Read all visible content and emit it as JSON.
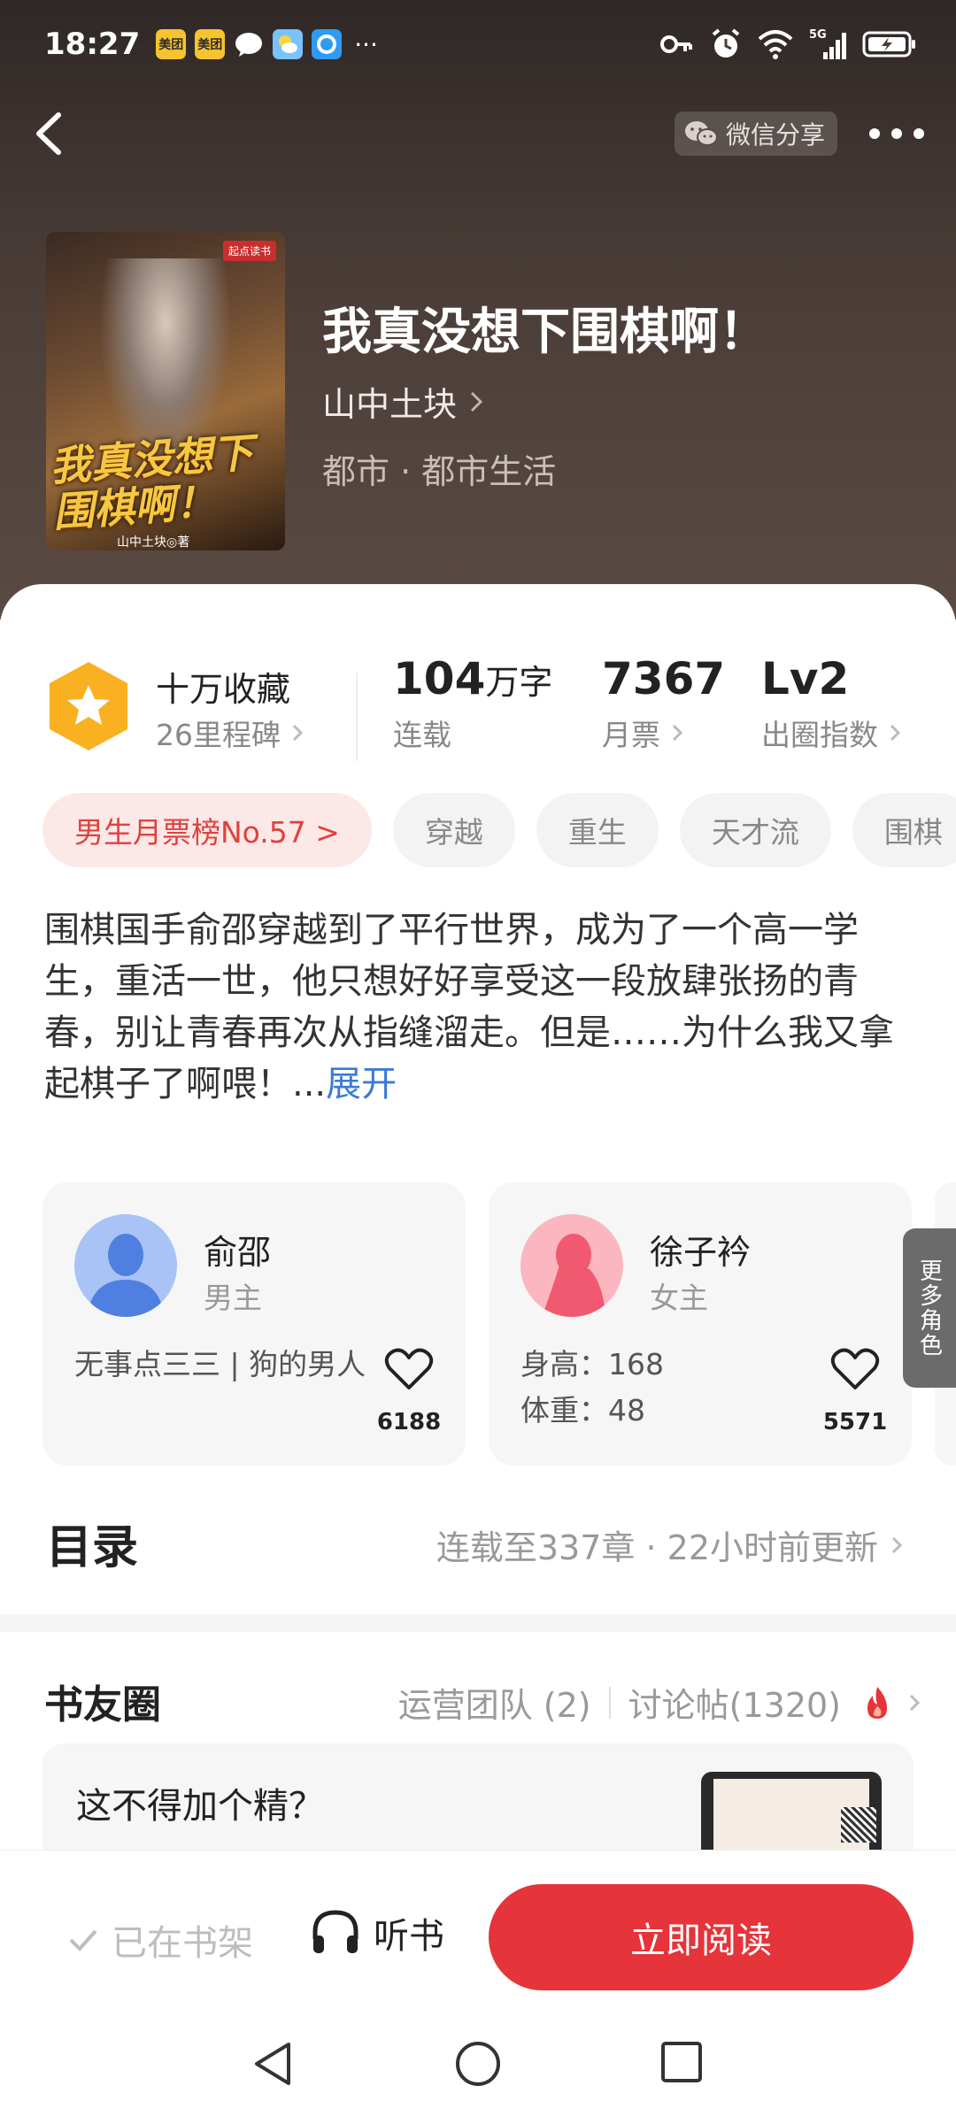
{
  "status_bar": {
    "time": "18:27",
    "app_icons": [
      {
        "name": "meituan-icon",
        "label": "美团",
        "color": "#f7c32e"
      },
      {
        "name": "meituan-icon",
        "label": "美团",
        "color": "#f7c32e"
      },
      {
        "name": "message-icon",
        "label": "",
        "color": "#ffffff"
      },
      {
        "name": "weather-icon",
        "label": "",
        "color": "#78c2ff"
      },
      {
        "name": "browser-icon",
        "label": "",
        "color": "#2f9bf0"
      }
    ],
    "more": "···",
    "network": "5G"
  },
  "header": {
    "share_label": "微信分享",
    "cover_tag": "起点读书",
    "cover_title": "我真没想下围棋啊！",
    "cover_subtitle": "山中土块◎著"
  },
  "book": {
    "title": "我真没想下围棋啊！",
    "author": "山中土块",
    "genre": "都市 · 都市生活"
  },
  "stats": {
    "favorites_title": "十万收藏",
    "favorites_sub": "26里程碑",
    "words_num": "104",
    "words_unit": "万字",
    "words_label": "连载",
    "tickets_num": "7367",
    "tickets_label": "月票",
    "level_num": "Lv2",
    "level_label": "出圈指数"
  },
  "tags": [
    {
      "label": "男生月票榜No.57 >",
      "kind": "rank"
    },
    {
      "label": "穿越",
      "kind": "normal"
    },
    {
      "label": "重生",
      "kind": "normal"
    },
    {
      "label": "天才流",
      "kind": "normal"
    },
    {
      "label": "围棋",
      "kind": "normal"
    }
  ],
  "description": {
    "text": "围棋国手俞邵穿越到了平行世界，成为了一个高一学生，重活一世，他只想好好享受这一段放肆张扬的青春，别让青春再次从指缝溜走。但是……为什么我又拿起棋子了啊喂！...",
    "expand": "展开"
  },
  "characters": [
    {
      "name": "俞邵",
      "role": "男主",
      "info": "无事点三三 | 狗的男人",
      "likes": "6188",
      "color": "#7ba3ef"
    },
    {
      "name": "徐子衿",
      "role": "女主",
      "info": "身高：168\n体重：48",
      "likes": "5571",
      "color": "#f27d8d"
    }
  ],
  "more_roles": "更多角色",
  "toc": {
    "title": "目录",
    "meta": "连载至337章 · 22小时前更新"
  },
  "circle": {
    "title": "书友圈",
    "ops": "运营团队 (2)",
    "posts": "讨论帖(1320)"
  },
  "post": {
    "title": "这不得加个精？"
  },
  "bottom_bar": {
    "shelf": "已在书架",
    "listen": "听书",
    "read": "立即阅读"
  }
}
